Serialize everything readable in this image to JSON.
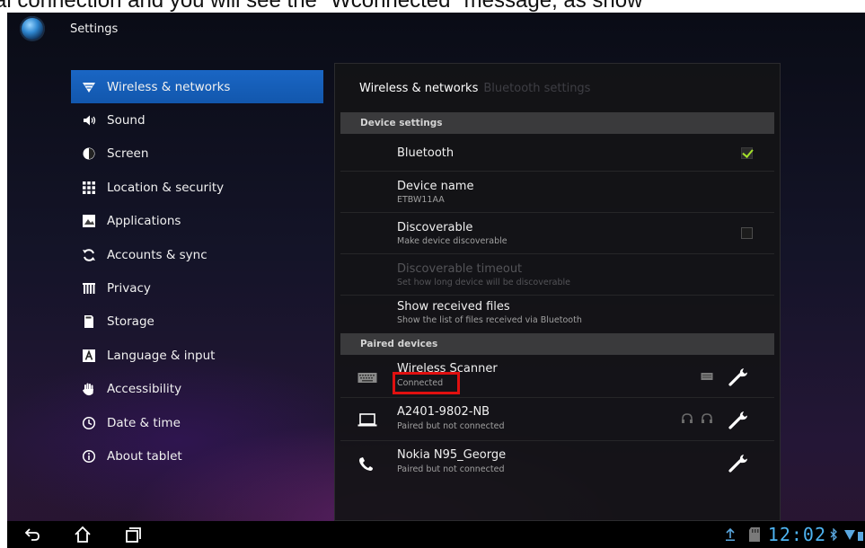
{
  "caption": "al connection and you will see the \"Wconnected\" message, as show",
  "window": {
    "title": "Settings",
    "icon": "settings-gear-icon"
  },
  "sidebar": {
    "items": [
      {
        "label": "Wireless & networks",
        "icon": "wifi-icon",
        "active": true
      },
      {
        "label": "Sound",
        "icon": "speaker-icon"
      },
      {
        "label": "Screen",
        "icon": "brightness-icon"
      },
      {
        "label": "Location & security",
        "icon": "grid-lock-icon"
      },
      {
        "label": "Applications",
        "icon": "applications-icon"
      },
      {
        "label": "Accounts & sync",
        "icon": "sync-icon"
      },
      {
        "label": "Privacy",
        "icon": "privacy-icon"
      },
      {
        "label": "Storage",
        "icon": "storage-icon"
      },
      {
        "label": "Language & input",
        "icon": "keyboard-a-icon"
      },
      {
        "label": "Accessibility",
        "icon": "hand-icon"
      },
      {
        "label": "Date & time",
        "icon": "clock-icon"
      },
      {
        "label": "About tablet",
        "icon": "info-icon"
      }
    ]
  },
  "panel": {
    "breadcrumb_active": "Wireless & networks",
    "breadcrumb_inactive": "Bluetooth settings",
    "device_settings_header": "Device settings",
    "bluetooth": {
      "label": "Bluetooth",
      "checked": true
    },
    "device_name": {
      "label": "Device name",
      "value": "ETBW11AA"
    },
    "discoverable": {
      "label": "Discoverable",
      "sub": "Make device discoverable",
      "checked": false
    },
    "discoverable_timeout": {
      "label": "Discoverable timeout",
      "sub": "Set how long device will be discoverable",
      "enabled": false
    },
    "received_files": {
      "label": "Show received files",
      "sub": "Show the list of files received via Bluetooth"
    },
    "paired_header": "Paired devices",
    "paired_devices": [
      {
        "name": "Wireless Scanner",
        "status": "Connected",
        "icon": "keyboard-icon",
        "profile_icons": [
          "input-device-icon"
        ]
      },
      {
        "name": "A2401-9802-NB",
        "status": "Paired but not connected",
        "icon": "laptop-icon",
        "profile_icons": [
          "headset-icon",
          "headphones-icon"
        ]
      },
      {
        "name": "Nokia N95_George",
        "status": "Paired but not connected",
        "icon": "phone-icon",
        "profile_icons": []
      }
    ]
  },
  "navbar": {
    "back": "back-icon",
    "home": "home-icon",
    "recent": "recent-apps-icon"
  },
  "status": {
    "time": "12:02",
    "icons": [
      "upload-icon",
      "sd-card-icon",
      "bluetooth-icon",
      "wifi-signal-icon",
      "battery-icon"
    ]
  },
  "colors": {
    "accent": "#1a66c4",
    "clock": "#4db3f0",
    "check": "#a4e22a",
    "highlight": "#e01010"
  }
}
